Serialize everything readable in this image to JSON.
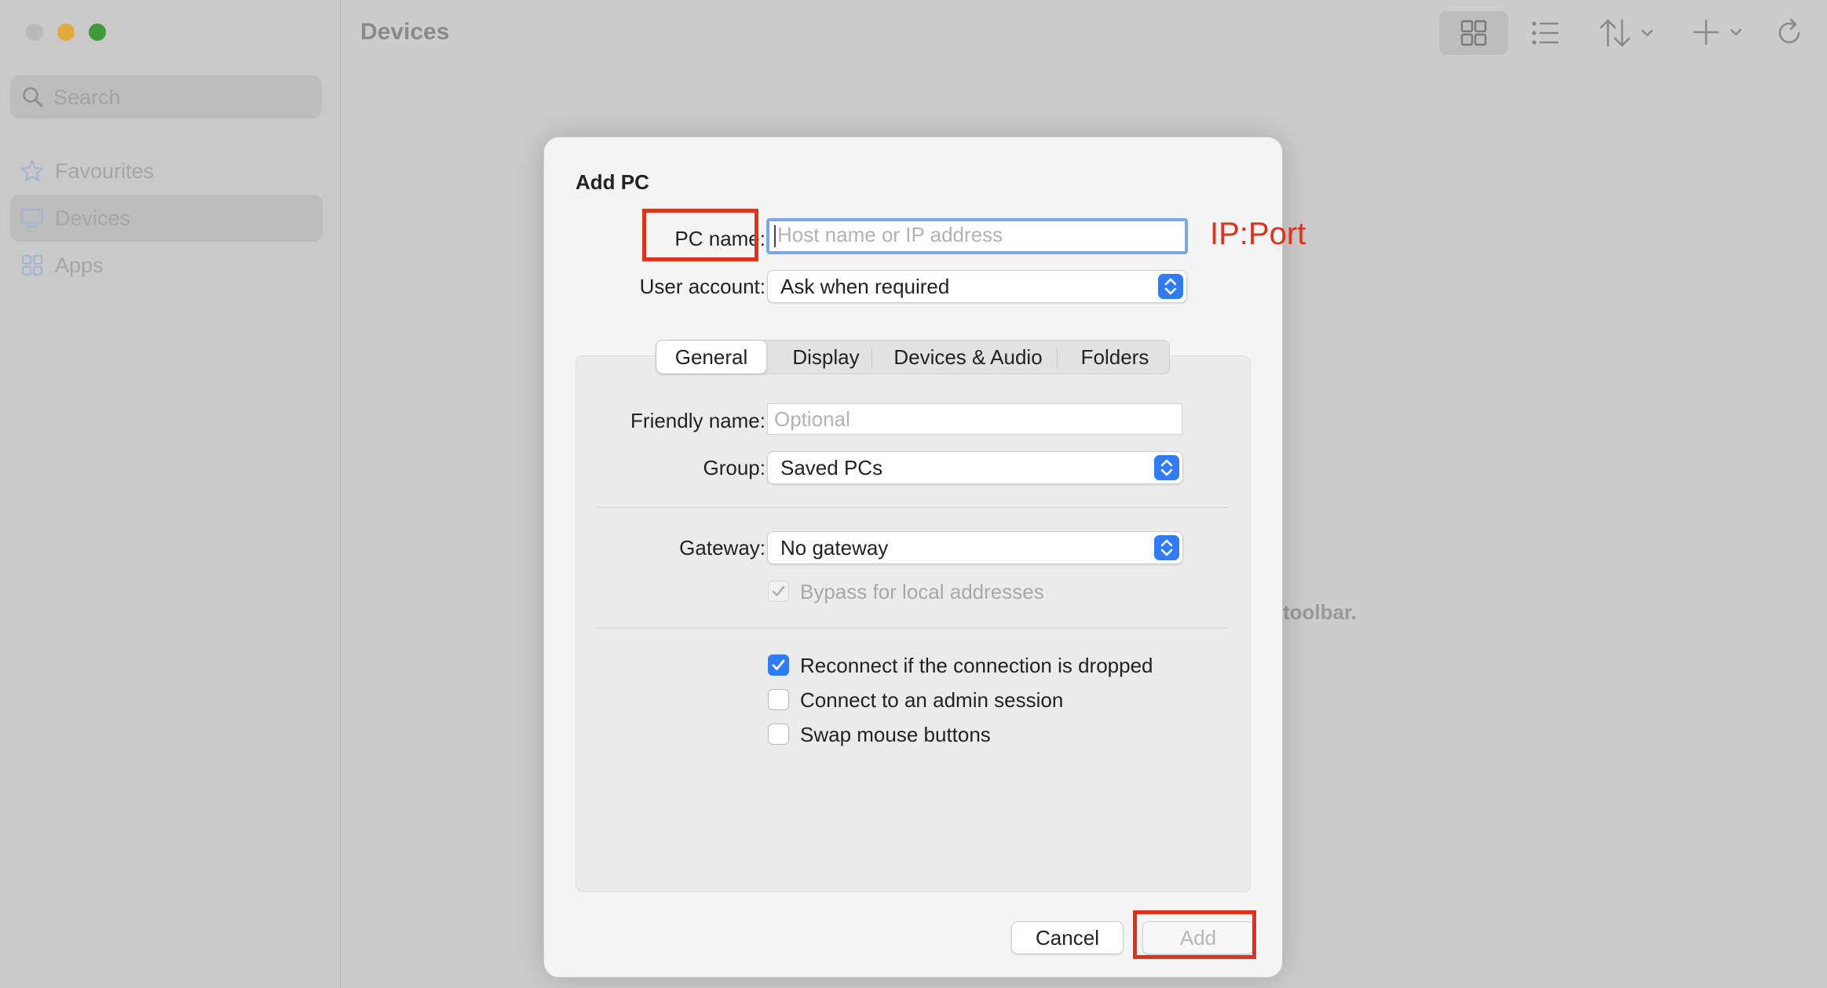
{
  "sidebar": {
    "search_placeholder": "Search",
    "items": [
      {
        "label": "Favourites",
        "icon": "star-icon"
      },
      {
        "label": "Devices",
        "icon": "monitor-icon"
      },
      {
        "label": "Apps",
        "icon": "apps-grid-icon"
      }
    ]
  },
  "main": {
    "title": "Devices",
    "background_hint": "toolbar.",
    "toolbar": [
      "grid-view-icon",
      "list-view-icon",
      "sort-icon",
      "add-icon",
      "refresh-icon"
    ]
  },
  "dialog": {
    "title": "Add PC",
    "pc_name_label": "PC name:",
    "pc_name_placeholder": "Host name or IP address",
    "pc_name_value": "",
    "user_account_label": "User account:",
    "user_account_value": "Ask when required",
    "tabs": [
      "General",
      "Display",
      "Devices & Audio",
      "Folders"
    ],
    "selected_tab": "General",
    "friendly_name_label": "Friendly name:",
    "friendly_name_placeholder": "Optional",
    "group_label": "Group:",
    "group_value": "Saved PCs",
    "gateway_label": "Gateway:",
    "gateway_value": "No gateway",
    "bypass_label": "Bypass for local addresses",
    "bypass_checked": true,
    "options": [
      {
        "label": "Reconnect if the connection is dropped",
        "checked": true
      },
      {
        "label": "Connect to an admin session",
        "checked": false
      },
      {
        "label": "Swap mouse buttons",
        "checked": false
      }
    ],
    "cancel_label": "Cancel",
    "add_label": "Add"
  },
  "annotation": {
    "text": "IP:Port",
    "color": "#e0301e"
  },
  "colors": {
    "accent": "#2f7cf6",
    "focus_ring": "#7aa7e6"
  }
}
